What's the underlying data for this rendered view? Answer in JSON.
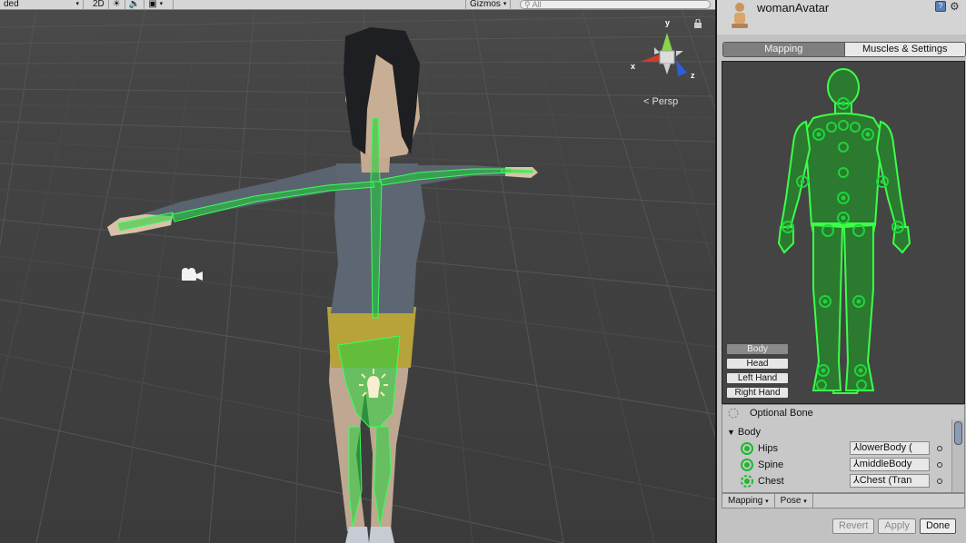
{
  "scene": {
    "toolbar": {
      "shading_mode": "ded",
      "mode_2d": "2D",
      "gizmos_label": "Gizmos",
      "search_placeholder": "All"
    },
    "gizmo": {
      "x_label": "x",
      "y_label": "y",
      "z_label": "z"
    },
    "projection_label": "Persp"
  },
  "inspector": {
    "title": "womanAvatar",
    "tabs": [
      "Mapping",
      "Muscles & Settings"
    ],
    "active_tab": "Mapping",
    "body_parts": [
      "Body",
      "Head",
      "Left Hand",
      "Right Hand"
    ],
    "active_part": "Body",
    "legend": {
      "optional_bone": "Optional Bone"
    },
    "group": "Body",
    "bones": [
      {
        "label": "Hips",
        "value": "lowerBody ("
      },
      {
        "label": "Spine",
        "value": "middleBody"
      },
      {
        "label": "Chest",
        "value": "Chest (Tran"
      }
    ],
    "bottom_dropdowns": [
      "Mapping",
      "Pose"
    ],
    "buttons": {
      "revert": "Revert",
      "apply": "Apply",
      "done": "Done"
    },
    "colors": {
      "bone_green": "#1fd43a",
      "figure_green": "#2b7a2f"
    }
  }
}
